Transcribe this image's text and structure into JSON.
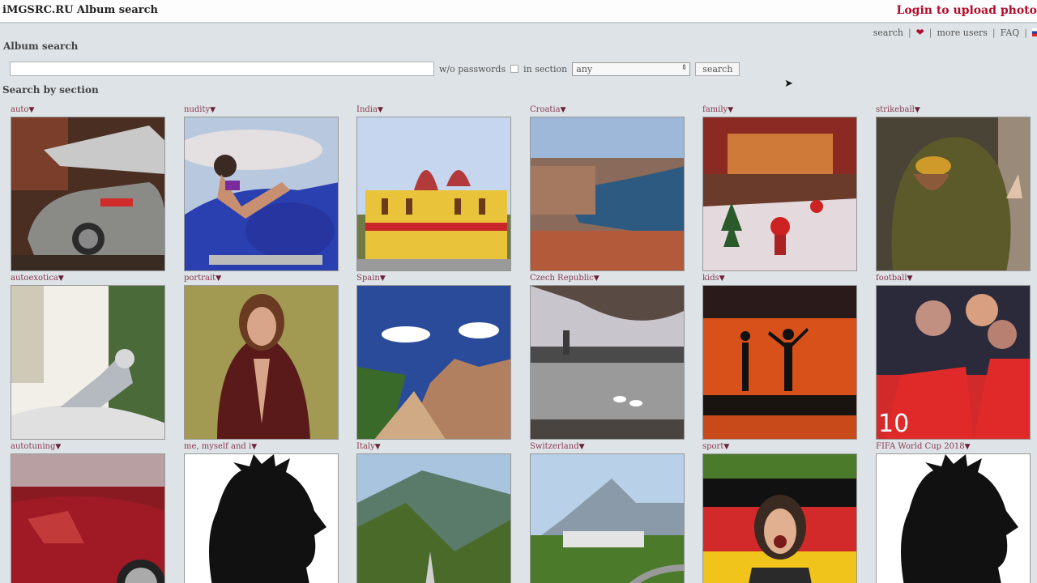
{
  "header": {
    "site_title": "iMGSRC.RU Album search",
    "login_link": "Login to upload photo"
  },
  "topnav": {
    "search": "search",
    "heart": "❤",
    "more_users": "more users",
    "faq": "FAQ",
    "sep": "|"
  },
  "album_search": {
    "heading": "Album search",
    "query_value": "",
    "wo_passwords_label": "w/o passwords",
    "in_section_label": "in section",
    "section_selected": "any",
    "search_button": "search"
  },
  "sections_heading": "Search by section",
  "tiles": [
    {
      "label": "auto",
      "theme": "car"
    },
    {
      "label": "nudity",
      "theme": "moto"
    },
    {
      "label": "India",
      "theme": "temple"
    },
    {
      "label": "Croatia",
      "theme": "harbor"
    },
    {
      "label": "family",
      "theme": "xmas"
    },
    {
      "label": "strikeball",
      "theme": "ghillie"
    },
    {
      "label": "autoexotica",
      "theme": "ornament"
    },
    {
      "label": "portrait",
      "theme": "portrait"
    },
    {
      "label": "Spain",
      "theme": "rocks"
    },
    {
      "label": "Czech Republic",
      "theme": "prague"
    },
    {
      "label": "kids",
      "theme": "sunset"
    },
    {
      "label": "football",
      "theme": "football"
    },
    {
      "label": "autotuning",
      "theme": "redcar"
    },
    {
      "label": "me, myself and i",
      "theme": "silhouette"
    },
    {
      "label": "Italy",
      "theme": "valley"
    },
    {
      "label": "Switzerland",
      "theme": "alps"
    },
    {
      "label": "sport",
      "theme": "fan"
    },
    {
      "label": "FIFA World Cup 2018",
      "theme": "silhouette"
    }
  ]
}
